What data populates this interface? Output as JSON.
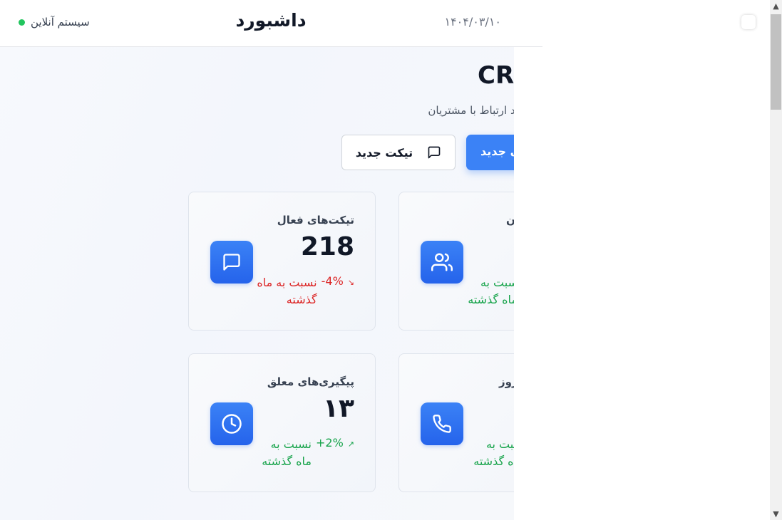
{
  "header": {
    "status_text": "سیستم آنلاین",
    "title": "داشبورد",
    "date": "۱۴۰۴/۰۳/۱۰"
  },
  "hero": {
    "title": "CR",
    "subtitle": "ند ارتباط با مشتریان",
    "new_ticket_label": "تیکت جدید",
    "new_customer_label": "ی جدید"
  },
  "cards": [
    {
      "label": "تیکت‌های فعال",
      "value": "218",
      "change": "-4%",
      "change_note": "نسبت به ماه گذشته",
      "trend": "down",
      "icon": "chat-icon"
    },
    {
      "label": "ن",
      "value": "",
      "change": "",
      "change_note": "سبت به ماه گذشته",
      "trend": "up",
      "icon": "users-icon"
    },
    {
      "label": "پیگیری‌های معلق",
      "value": "۱۳",
      "change": "+2%",
      "change_note": "نسبت به ماه گذشته",
      "trend": "up",
      "icon": "clock-icon"
    },
    {
      "label": "روز",
      "value": "",
      "change": "",
      "change_note": "سبت به ماه گذشته",
      "trend": "up",
      "icon": "phone-icon"
    }
  ],
  "colors": {
    "accent": "#3b82f6",
    "positive": "#16a34a",
    "negative": "#dc2626",
    "online": "#22c55e"
  }
}
